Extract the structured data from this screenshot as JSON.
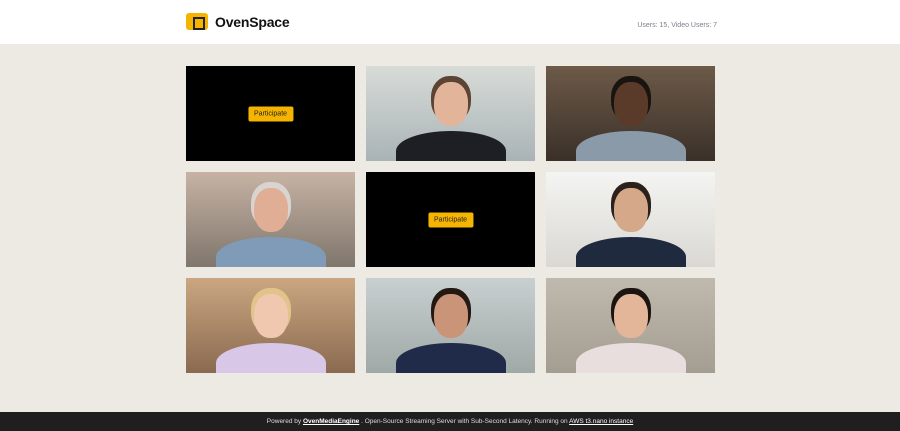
{
  "header": {
    "app_name": "OvenSpace",
    "users_label": "Users: 15, Video Users: 7"
  },
  "tiles": [
    {
      "type": "empty",
      "button": "Participate"
    },
    {
      "type": "video",
      "bg1": "#d8dcd8",
      "bg2": "#a9b3b6",
      "skin": "#e2b59a",
      "shirt": "#1d1f24",
      "hair": "#5b4434"
    },
    {
      "type": "video",
      "bg1": "#6d5a48",
      "bg2": "#3a3029",
      "skin": "#5a3a28",
      "shirt": "#8b9aa8",
      "hair": "#1a1410"
    },
    {
      "type": "video",
      "bg1": "#c6b3a4",
      "bg2": "#80766c",
      "skin": "#dfae95",
      "shirt": "#7f9bb8",
      "hair": "#d9d4cf"
    },
    {
      "type": "empty",
      "button": "Participate"
    },
    {
      "type": "video",
      "bg1": "#f4f4f2",
      "bg2": "#d9d8d3",
      "skin": "#d6a88a",
      "shirt": "#1f2a3f",
      "hair": "#2b201a"
    },
    {
      "type": "video",
      "bg1": "#caa781",
      "bg2": "#8a6a50",
      "skin": "#f0c8b0",
      "shirt": "#d8c7e6",
      "hair": "#e2c48b"
    },
    {
      "type": "video",
      "bg1": "#c8cfd0",
      "bg2": "#9fa9a6",
      "skin": "#c99478",
      "shirt": "#1f2b48",
      "hair": "#241812"
    },
    {
      "type": "video",
      "bg1": "#bfb9ae",
      "bg2": "#a49e92",
      "skin": "#e3b69a",
      "shirt": "#e8dede",
      "hair": "#1c1411"
    }
  ],
  "footer": {
    "powered_by": "Powered by",
    "engine_link": "OvenMediaEngine",
    "description": ". Open-Source Streaming Server with Sub-Second Latency. Running on",
    "instance_link": "AWS t3.nano instance"
  },
  "colors": {
    "accent": "#f5b400",
    "footer_bg": "#1f1f1f",
    "page_bg": "#edeae4"
  }
}
